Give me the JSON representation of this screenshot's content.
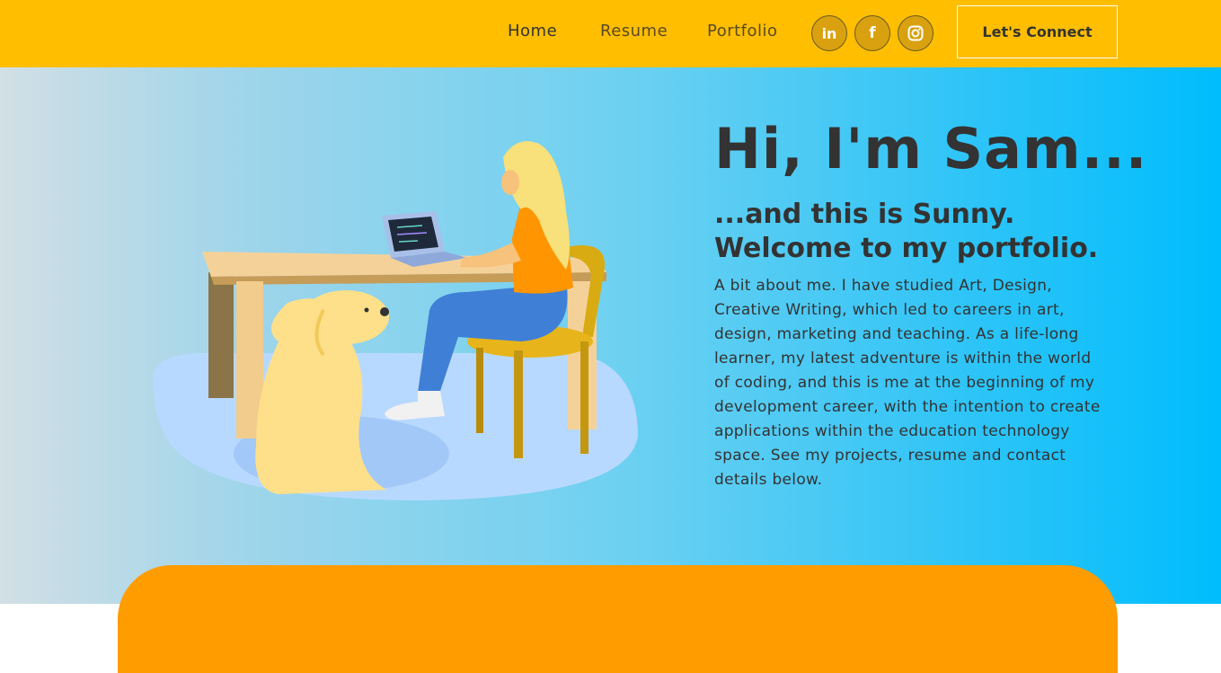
{
  "nav": {
    "links": [
      "Home",
      "Resume",
      "Portfolio"
    ],
    "social": [
      {
        "icon": "linkedin-icon",
        "label": "in"
      },
      {
        "icon": "facebook-icon",
        "label": "f"
      },
      {
        "icon": "instagram-icon"
      }
    ],
    "cta_label": "Let's Connect"
  },
  "hero": {
    "title": "Hi, I'm Sam...",
    "subtitle": "...and this is Sunny. Welcome to my portfolio.",
    "body": "A bit about me. I have studied Art, Design, Creative Writing, which led to careers in art, design, marketing and teaching. As a life-long learner, my latest adventure is within the world of coding, and this is me at the beginning of my development career, with the intention to create applications within the education technology space. See my projects, resume and contact details below."
  },
  "colors": {
    "navbar": "#ffbe00",
    "accent_orange": "#ff9c00",
    "hero_gradient_start": "#d2dfe5",
    "hero_gradient_end": "#00bdfd",
    "text": "#333333"
  }
}
